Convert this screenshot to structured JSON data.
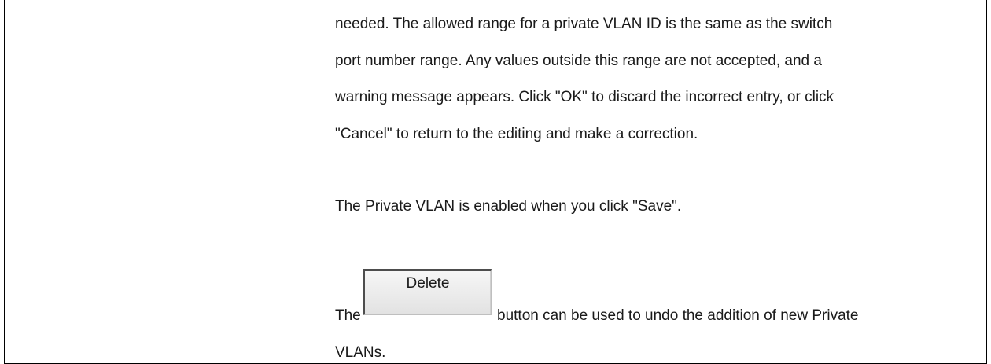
{
  "paragraph_1": {
    "line_1": "needed. The allowed range for a private VLAN ID is the same as the switch",
    "line_2": "port number range. Any values outside this range are not accepted, and a",
    "line_3": "warning message appears. Click \"OK\" to discard the incorrect entry, or click",
    "line_4": "\"Cancel\" to return to the editing and make a correction."
  },
  "paragraph_2": "The Private VLAN is enabled when you click \"Save\".",
  "paragraph_3": {
    "prefix": "The",
    "button_label": "Delete",
    "suffix": "button can be used to undo the addition of new Private",
    "line_2": "VLANs."
  }
}
